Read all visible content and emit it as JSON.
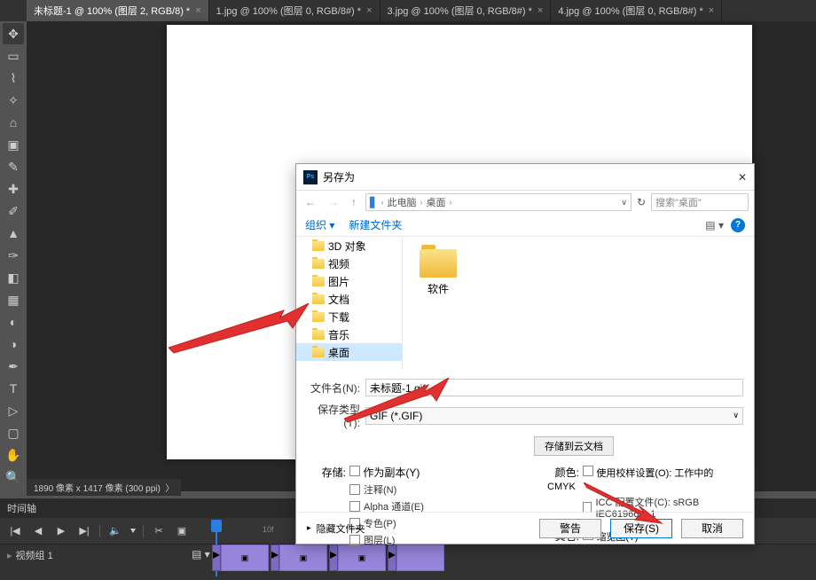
{
  "tabs": [
    {
      "label": "未标题-1 @ 100% (图层 2, RGB/8) *"
    },
    {
      "label": "1.jpg @ 100% (图层 0, RGB/8#) *"
    },
    {
      "label": "3.jpg @ 100% (图层 0, RGB/8#) *"
    },
    {
      "label": "4.jpg @ 100% (图层 0, RGB/8#) *"
    }
  ],
  "status": "1890 像素 x 1417 像素 (300 ppi)",
  "timeline": {
    "title": "时间轴",
    "videoGroup": "视频组 1",
    "ruler10": "10f"
  },
  "dialog": {
    "title": "另存为",
    "breadcrumb": {
      "root": "此电脑",
      "folder": "桌面"
    },
    "searchPlaceholder": "搜索\"桌面\"",
    "organize": "组织",
    "newFolder": "新建文件夹",
    "tree": {
      "objects3d": "3D 对象",
      "videos": "视频",
      "pictures": "图片",
      "documents": "文档",
      "downloads": "下载",
      "music": "音乐",
      "desktop": "桌面"
    },
    "folderItem": "软件",
    "filenameLabel": "文件名(N):",
    "filenameValue": "未标题-1.gif",
    "typeLabel": "保存类型(T):",
    "typeValue": "GIF (*.GIF)",
    "cloudButton": "存储到云文档",
    "storageLabel": "存储:",
    "asCopy": "作为副本(Y)",
    "notes": "注释(N)",
    "alpha": "Alpha 通道(E)",
    "spot": "专色(P)",
    "layers": "图层(L)",
    "colorLabel": "颜色:",
    "colorOpt": "使用校样设置(O): 工作中的 CMYK",
    "icc": "ICC 配置文件(C): sRGB IEC61966-2.1",
    "otherLabel": "其它:",
    "thumbnail": "缩览图(T)",
    "hideFolders": "隐藏文件夹",
    "warn": "警告",
    "save": "保存(S)",
    "cancel": "取消"
  }
}
